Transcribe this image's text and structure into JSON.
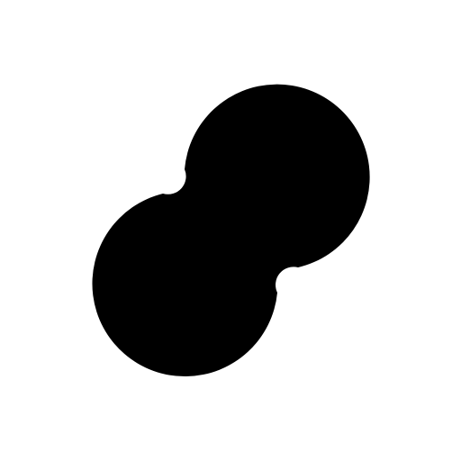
{
  "canvas": {
    "background_color": "#ffffff"
  },
  "logo": {
    "icon_name": "peanut-blob-logo",
    "fill_color": "#000000",
    "shape": "two overlapping circles joined by smooth fillets"
  }
}
